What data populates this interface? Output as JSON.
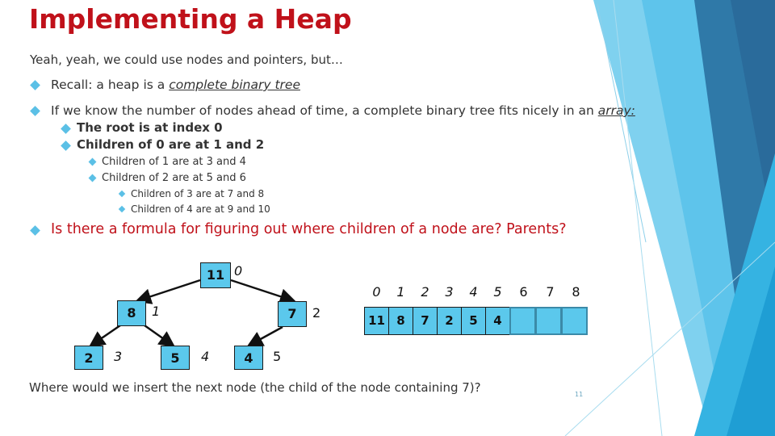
{
  "slide": {
    "title": "Implementing a Heap",
    "intro": "Yeah, yeah, we could use nodes and pointers, but…",
    "bullets": {
      "recall_prefix": "Recall: a heap is a ",
      "recall_link": "complete binary tree",
      "know_prefix": "If we know the number of nodes ahead of time,  a complete binary tree fits nicely in an ",
      "know_link": "array:",
      "root": "The root is at index 0",
      "children0": "Children of 0 are at 1 and 2",
      "children1": "Children of 1 are at 3 and 4",
      "children2": "Children of 2 are at 5 and 6",
      "children3": "Children of 3 are at 7 and 8",
      "children4": "Children of 4 are at 9 and 10",
      "formula": "Is there a formula for figuring out where children of a node are?  Parents?"
    },
    "tree": {
      "nodes": [
        {
          "value": "11",
          "index": "0"
        },
        {
          "value": "8",
          "index": "1"
        },
        {
          "value": "7",
          "index": "2"
        },
        {
          "value": "2",
          "index": "3"
        },
        {
          "value": "5",
          "index": "4"
        },
        {
          "value": "4",
          "index": "5"
        }
      ]
    },
    "array": {
      "indices": [
        "0",
        "1",
        "2",
        "3",
        "4",
        "5",
        "6",
        "7",
        "8"
      ],
      "values": [
        "11",
        "8",
        "7",
        "2",
        "5",
        "4",
        "",
        "",
        ""
      ]
    },
    "question": "Where would we insert the next node (the child of the node containing 7)?",
    "page_number": "11"
  },
  "colors": {
    "title": "#c0111a",
    "node_fill": "#5bc8ec",
    "bullet": "#5bc0e6"
  }
}
